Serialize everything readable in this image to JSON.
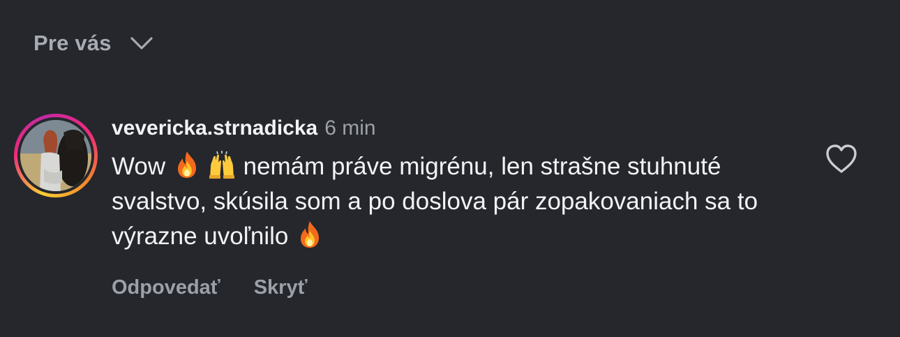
{
  "sort": {
    "label": "Pre vás",
    "icon": "chevron-down-icon"
  },
  "comment": {
    "username": "vevericka.strnadicka",
    "time": "6 min",
    "text": {
      "part1": "Wow ",
      "part2": " nemám práve migrénu, len strašne stuhnuté svalstvo, skúsila som a po doslova pár zopakovaniach sa to výrazne uvoľnilo ",
      "emojis": [
        "fire-emoji",
        "raising-hands-emoji",
        "fire-emoji"
      ]
    },
    "actions": {
      "reply": "Odpovedať",
      "hide": "Skryť"
    },
    "like_icon": "heart-icon"
  },
  "colors": {
    "background": "#25272c",
    "primary_text": "#f2f3f5",
    "secondary_text": "#9ca0a8"
  }
}
